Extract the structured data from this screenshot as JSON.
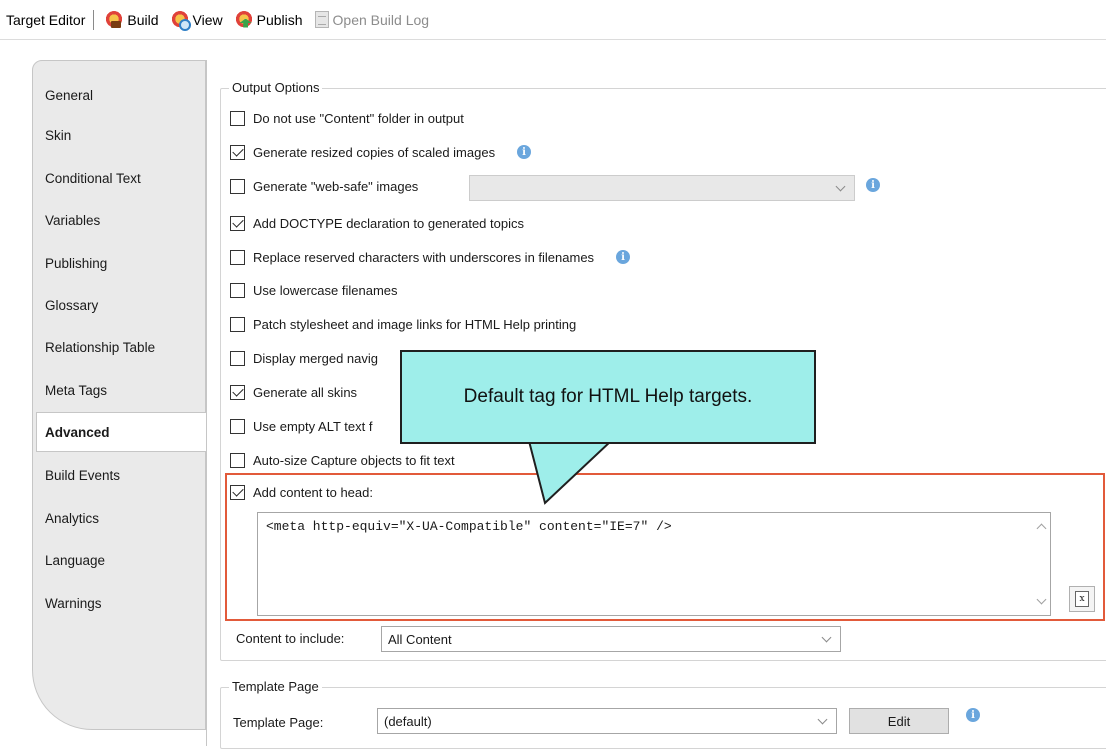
{
  "toolbar": {
    "title": "Target Editor",
    "build_label": "Build",
    "view_label": "View",
    "publish_label": "Publish",
    "open_build_log_label": "Open Build Log"
  },
  "tabs": [
    {
      "label": "General"
    },
    {
      "label": "Skin"
    },
    {
      "label": "Conditional Text"
    },
    {
      "label": "Variables"
    },
    {
      "label": "Publishing"
    },
    {
      "label": "Glossary"
    },
    {
      "label": "Relationship Table"
    },
    {
      "label": "Meta Tags"
    },
    {
      "label": "Advanced",
      "active": true
    },
    {
      "label": "Build Events"
    },
    {
      "label": "Analytics"
    },
    {
      "label": "Language"
    },
    {
      "label": "Warnings"
    }
  ],
  "output_options": {
    "title": "Output Options",
    "options": [
      {
        "label": "Do not use \"Content\" folder in output",
        "checked": false
      },
      {
        "label": "Generate resized copies of scaled images",
        "checked": true,
        "info": true
      },
      {
        "label": "Generate \"web-safe\" images",
        "checked": false,
        "info": true
      },
      {
        "label": "Add DOCTYPE declaration to generated topics",
        "checked": true
      },
      {
        "label": "Replace reserved characters with underscores in filenames",
        "checked": false,
        "info": true
      },
      {
        "label": "Use lowercase filenames",
        "checked": false
      },
      {
        "label": "Patch stylesheet and image links for HTML Help printing",
        "checked": false
      },
      {
        "label": "Display merged navig",
        "checked": false
      },
      {
        "label": "Generate all skins",
        "checked": true
      },
      {
        "label": "Use empty ALT text f",
        "checked": false
      },
      {
        "label": "Auto-size Capture objects to fit text",
        "checked": false
      },
      {
        "label": "Add content to head:",
        "checked": true
      }
    ],
    "web_safe_select_value": "",
    "head_content": "<meta http-equiv=\"X-UA-Compatible\" content=\"IE=7\" />",
    "content_to_include_label": "Content to include:",
    "content_to_include_value": "All Content"
  },
  "template_page": {
    "title": "Template Page",
    "label": "Template Page:",
    "value": "(default)",
    "edit_label": "Edit"
  },
  "callout": {
    "text": "Default tag for HTML Help targets."
  },
  "colors": {
    "callout_fill": "#9eeeea",
    "highlight_border": "#e25a3a",
    "info_icon": "#6aa6dd"
  }
}
